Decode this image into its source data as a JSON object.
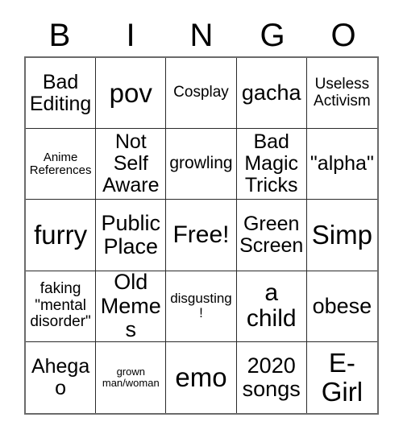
{
  "card": {
    "title": "BINGO",
    "header_letters": [
      "B",
      "I",
      "N",
      "G",
      "O"
    ],
    "free_space_label": "Free!",
    "grid_line_color": "#2a2a2a",
    "border_color": "#6b6b6b",
    "background_color": "#ffffff",
    "text_color": "#000000",
    "rows": [
      [
        {
          "label": "Bad\nEditing",
          "size": "fs-l"
        },
        {
          "label": "pov",
          "size": "fs-huge"
        },
        {
          "label": "Cosplay",
          "size": "fs-m"
        },
        {
          "label": "gacha",
          "size": "fs-xl"
        },
        {
          "label": "Useless\nActivism",
          "size": "fs-m"
        }
      ],
      [
        {
          "label": "Anime\nReferences",
          "size": "fs-s"
        },
        {
          "label": "Not\nSelf\nAware",
          "size": "fs-l"
        },
        {
          "label": "growling",
          "size": "fs-ml"
        },
        {
          "label": "Bad\nMagic\nTricks",
          "size": "fs-l"
        },
        {
          "label": "\"alpha\"",
          "size": "fs-l"
        }
      ],
      [
        {
          "label": "furry",
          "size": "fs-huge"
        },
        {
          "label": "Public\nPlace",
          "size": "fs-xl"
        },
        {
          "label": "Free!",
          "size": "fs-xxl"
        },
        {
          "label": "Green\nScreen",
          "size": "fs-l"
        },
        {
          "label": "Simp",
          "size": "fs-huge"
        }
      ],
      [
        {
          "label": "faking\n\"mental\ndisorder\"",
          "size": "fs-m"
        },
        {
          "label": "Old\nMemes",
          "size": "fs-xl"
        },
        {
          "label": "disgusting!",
          "size": "fs-sm"
        },
        {
          "label": "a\nchild",
          "size": "fs-xxl"
        },
        {
          "label": "obese",
          "size": "fs-xl"
        }
      ],
      [
        {
          "label": "Ahegao",
          "size": "fs-l"
        },
        {
          "label": "grown\nman/woman",
          "size": "fs-xs"
        },
        {
          "label": "emo",
          "size": "fs-huge"
        },
        {
          "label": "2020\nsongs",
          "size": "fs-xl"
        },
        {
          "label": "E-\nGirl",
          "size": "fs-huge"
        }
      ]
    ]
  }
}
